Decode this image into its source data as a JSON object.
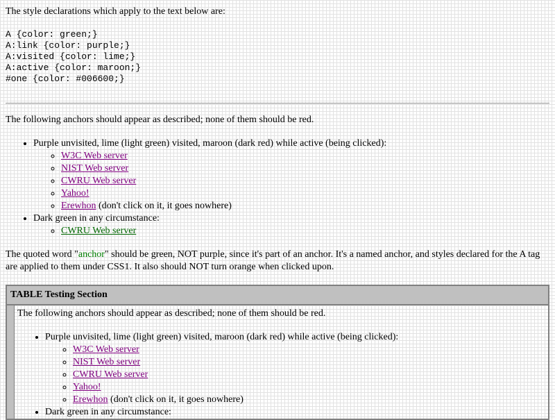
{
  "intro": "The style declarations which apply to the text below are:",
  "css_lines": [
    "A {color: green;}",
    "A:link {color: purple;}",
    "A:visited {color: lime;}",
    "A:active {color: maroon;}",
    "#one {color: #006600;}"
  ],
  "section": {
    "lead": "The following anchors should appear as described; none of them should be red.",
    "purple_item": "Purple unvisited, lime (light green) visited, maroon (dark red) while active (being clicked):",
    "links": {
      "w3c": "W3C Web server",
      "nist": "NIST Web server",
      "cwru": "CWRU Web server",
      "yahoo": "Yahoo!",
      "erewhon": "Erewhon",
      "erewhon_note": " (don't click on it, it goes nowhere)"
    },
    "green_item": "Dark green in any circumstance:",
    "green_link": "CWRU Web server"
  },
  "quoted": {
    "before": "The quoted word \"",
    "word": "anchor",
    "after": "\" should be green, NOT purple, since it's part of an anchor. It's a named anchor, and styles declared for the A tag are applied to them under CSS1. It also should NOT turn orange when clicked upon."
  },
  "table": {
    "title": "TABLE Testing Section"
  }
}
